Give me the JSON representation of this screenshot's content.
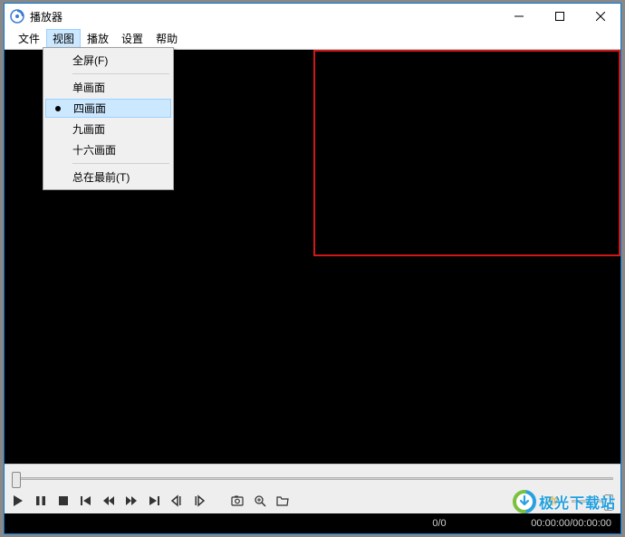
{
  "window": {
    "title": "播放器"
  },
  "menubar": {
    "items": [
      {
        "label": "文件"
      },
      {
        "label": "视图"
      },
      {
        "label": "播放"
      },
      {
        "label": "设置"
      },
      {
        "label": "帮助"
      }
    ]
  },
  "dropdown": {
    "group1": [
      {
        "label": "全屏(F)"
      }
    ],
    "group2": [
      {
        "label": "单画面"
      },
      {
        "label": "四画面"
      },
      {
        "label": "九画面"
      },
      {
        "label": "十六画面"
      }
    ],
    "group3": [
      {
        "label": "总在最前(T)"
      }
    ]
  },
  "status": {
    "counter": "0/0",
    "time": "00:00:00/00:00:00"
  },
  "watermark": {
    "text": "极光下载站"
  },
  "icons": {
    "play": "play-icon",
    "pause": "pause-icon",
    "stop": "stop-icon",
    "prev": "skip-start-icon",
    "rewind": "rewind-icon",
    "forward": "fast-forward-icon",
    "next": "skip-end-icon",
    "frame_back": "step-back-icon",
    "frame_fwd": "step-forward-icon",
    "snapshot": "camera-icon",
    "zoom": "zoom-icon",
    "open": "folder-open-icon",
    "volume": "volume-icon"
  }
}
